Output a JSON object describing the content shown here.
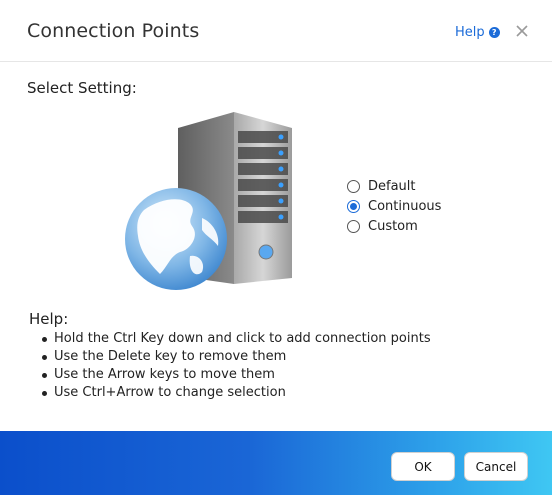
{
  "dialog": {
    "title": "Connection Points",
    "help_link": "Help",
    "help_icon": "question-circle-icon",
    "close_icon": "close-icon"
  },
  "setting": {
    "label": "Select Setting:",
    "illustration": "server-globe-icon",
    "options": [
      {
        "label": "Default",
        "selected": false
      },
      {
        "label": "Continuous",
        "selected": true
      },
      {
        "label": "Custom",
        "selected": false
      }
    ]
  },
  "help": {
    "title": "Help:",
    "items": [
      "Hold the Ctrl Key down and click to add connection points",
      "Use the Delete key to remove them",
      "Use the Arrow keys to move them",
      "Use Ctrl+Arrow to change selection"
    ]
  },
  "footer": {
    "ok_label": "OK",
    "cancel_label": "Cancel"
  },
  "colors": {
    "accent": "#1b6bd8",
    "footer_gradient_start": "#0b4fcb",
    "footer_gradient_end": "#3fc7f3"
  }
}
